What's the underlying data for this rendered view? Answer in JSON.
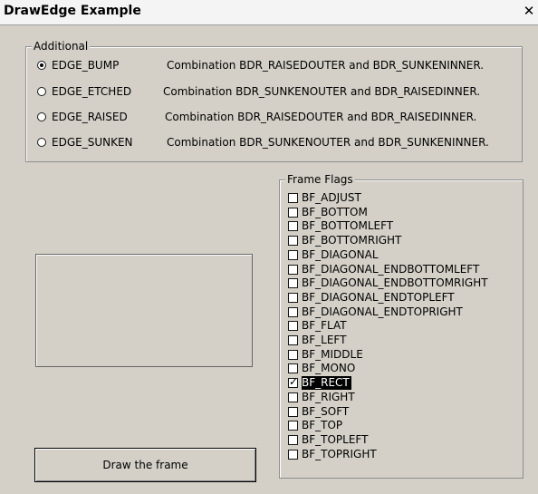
{
  "window": {
    "title": "DrawEdge Example",
    "close_glyph": "✕"
  },
  "additional": {
    "label": "Additional",
    "options": [
      {
        "label": "EDGE_BUMP",
        "description": "Combination BDR_RAISEDOUTER and BDR_SUNKENINNER.",
        "checked": true
      },
      {
        "label": "EDGE_ETCHED",
        "description": "Combination BDR_SUNKENOUTER and BDR_RAISEDINNER.",
        "checked": false
      },
      {
        "label": "EDGE_RAISED",
        "description": "Combination BDR_RAISEDOUTER and BDR_RAISEDINNER.",
        "checked": false
      },
      {
        "label": "EDGE_SUNKEN",
        "description": "Combination BDR_SUNKENOUTER and BDR_SUNKENINNER.",
        "checked": false
      }
    ]
  },
  "frame_flags": {
    "label": "Frame Flags",
    "flags": [
      {
        "label": "BF_ADJUST",
        "checked": false,
        "selected": false
      },
      {
        "label": "BF_BOTTOM",
        "checked": false,
        "selected": false
      },
      {
        "label": "BF_BOTTOMLEFT",
        "checked": false,
        "selected": false
      },
      {
        "label": "BF_BOTTOMRIGHT",
        "checked": false,
        "selected": false
      },
      {
        "label": "BF_DIAGONAL",
        "checked": false,
        "selected": false
      },
      {
        "label": "BF_DIAGONAL_ENDBOTTOMLEFT",
        "checked": false,
        "selected": false
      },
      {
        "label": "BF_DIAGONAL_ENDBOTTOMRIGHT",
        "checked": false,
        "selected": false
      },
      {
        "label": "BF_DIAGONAL_ENDTOPLEFT",
        "checked": false,
        "selected": false
      },
      {
        "label": "BF_DIAGONAL_ENDTOPRIGHT",
        "checked": false,
        "selected": false
      },
      {
        "label": "BF_FLAT",
        "checked": false,
        "selected": false
      },
      {
        "label": "BF_LEFT",
        "checked": false,
        "selected": false
      },
      {
        "label": "BF_MIDDLE",
        "checked": false,
        "selected": false
      },
      {
        "label": "BF_MONO",
        "checked": false,
        "selected": false
      },
      {
        "label": "BF_RECT",
        "checked": true,
        "selected": true
      },
      {
        "label": "BF_RIGHT",
        "checked": false,
        "selected": false
      },
      {
        "label": "BF_SOFT",
        "checked": false,
        "selected": false
      },
      {
        "label": "BF_TOP",
        "checked": false,
        "selected": false
      },
      {
        "label": "BF_TOPLEFT",
        "checked": false,
        "selected": false
      },
      {
        "label": "BF_TOPRIGHT",
        "checked": false,
        "selected": false
      }
    ]
  },
  "draw_button": {
    "label": "Draw the frame"
  }
}
